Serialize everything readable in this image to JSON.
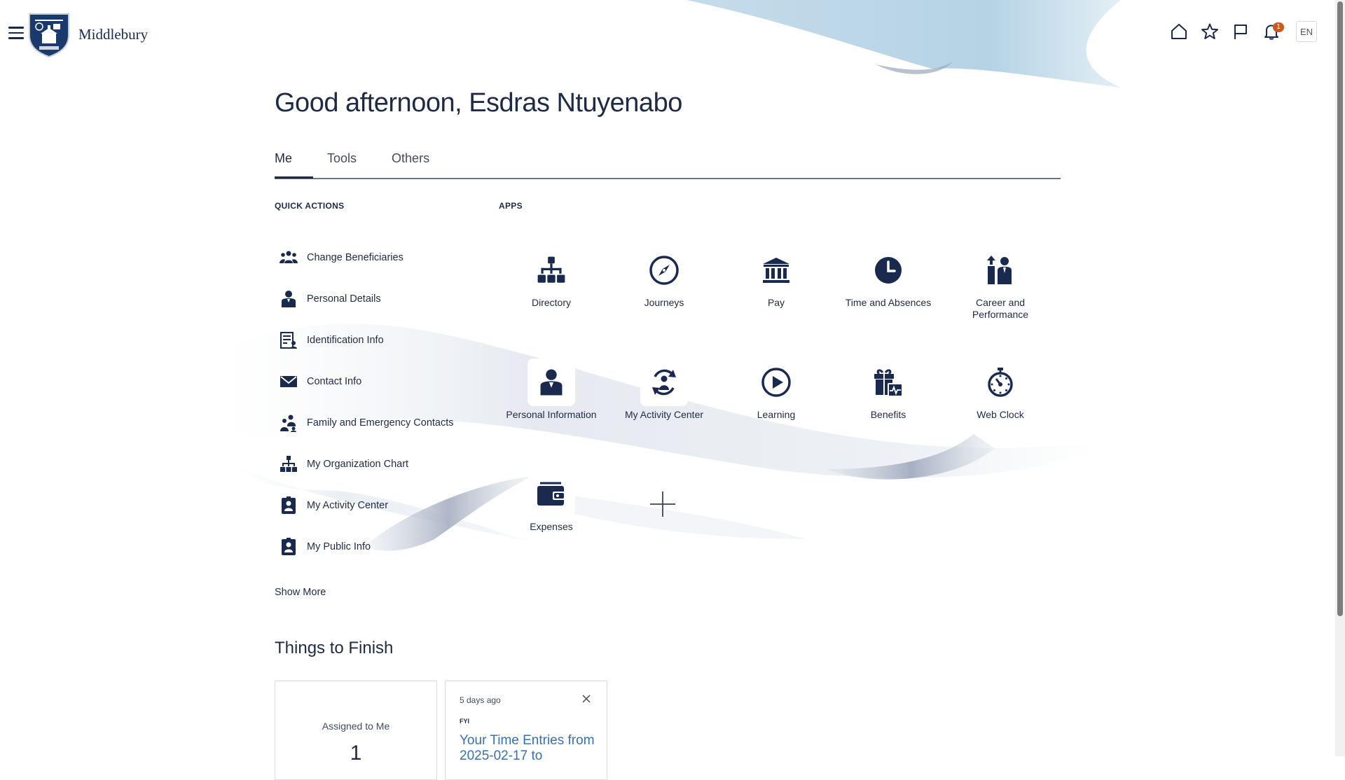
{
  "header": {
    "logo_text": "Middlebury",
    "notification_count": "1",
    "language": "EN"
  },
  "greeting": "Good afternoon, Esdras Ntuyenabo",
  "tabs": [
    {
      "label": "Me",
      "active": true
    },
    {
      "label": "Tools",
      "active": false
    },
    {
      "label": "Others",
      "active": false
    }
  ],
  "quick_actions": {
    "label": "QUICK ACTIONS",
    "items": [
      {
        "label": "Change Beneficiaries",
        "icon": "people-group-icon"
      },
      {
        "label": "Personal Details",
        "icon": "person-icon"
      },
      {
        "label": "Identification Info",
        "icon": "id-document-icon"
      },
      {
        "label": "Contact Info",
        "icon": "envelope-icon"
      },
      {
        "label": "Family and Emergency Contacts",
        "icon": "family-icon"
      },
      {
        "label": "My Organization Chart",
        "icon": "org-chart-icon"
      },
      {
        "label": "My Activity Center",
        "icon": "activity-badge-icon"
      },
      {
        "label": "My Public Info",
        "icon": "public-badge-icon"
      }
    ],
    "show_more": "Show More"
  },
  "apps": {
    "label": "APPS",
    "items": [
      {
        "label": "Directory",
        "icon": "org-chart-icon"
      },
      {
        "label": "Journeys",
        "icon": "compass-icon"
      },
      {
        "label": "Pay",
        "icon": "bank-icon"
      },
      {
        "label": "Time and Absences",
        "icon": "clock-icon"
      },
      {
        "label": "Career and Performance",
        "icon": "career-people-icon"
      },
      {
        "label": "Personal Information",
        "icon": "person-icon"
      },
      {
        "label": "My Activity Center",
        "icon": "activity-cycle-icon"
      },
      {
        "label": "Learning",
        "icon": "play-circle-icon"
      },
      {
        "label": "Benefits",
        "icon": "gift-icon"
      },
      {
        "label": "Web Clock",
        "icon": "stopwatch-icon"
      },
      {
        "label": "Expenses",
        "icon": "wallet-icon"
      }
    ]
  },
  "things_to_finish": {
    "title": "Things to Finish",
    "assigned_label": "Assigned to Me",
    "assigned_count": "1",
    "fyi_card": {
      "time_ago": "5 days ago",
      "type": "FYI",
      "title": "Your Time Entries from 2025-02-17 to"
    }
  },
  "colors": {
    "navy": "#1a2a4f",
    "wave_blue": "#b9d6e6",
    "link_blue": "#3a6fb0",
    "badge_orange": "#c85a1e"
  }
}
